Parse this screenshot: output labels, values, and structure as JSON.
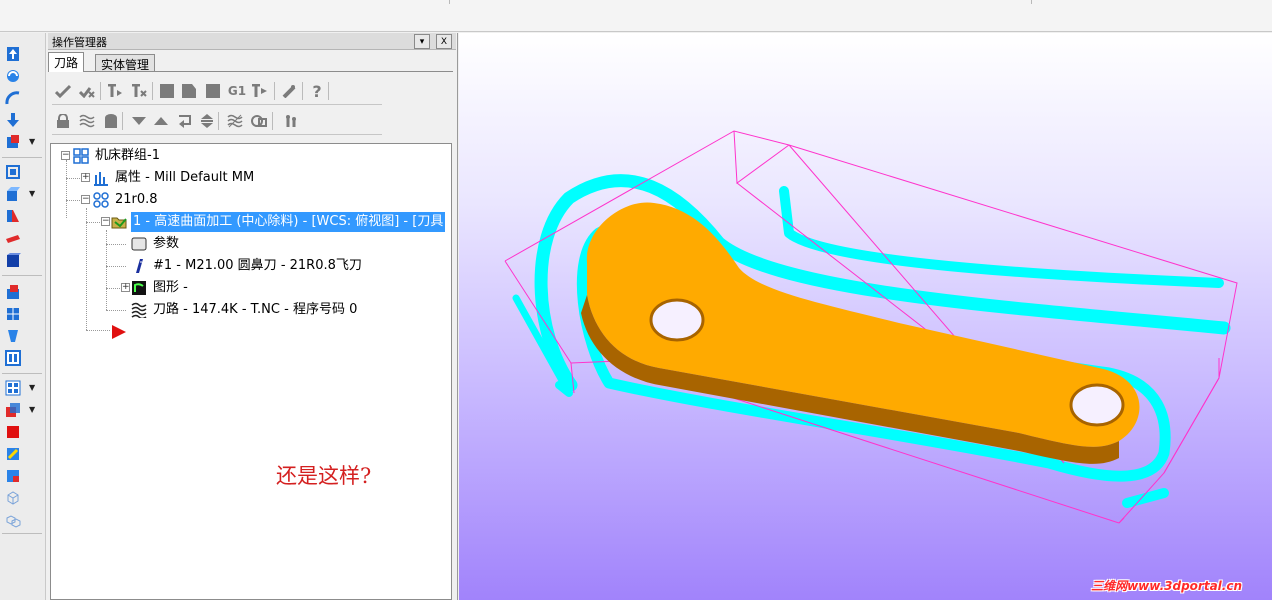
{
  "panel": {
    "title": "操作管理器",
    "pin_glyph": "▾",
    "close_glyph": "X",
    "tabs": [
      {
        "label": "刀路",
        "active": true
      },
      {
        "label": "实体管理",
        "active": false
      }
    ]
  },
  "toolbar_row1": [
    "select-all-ops-icon",
    "select-dirty-ops-icon",
    "regenerate-selected-icon",
    "regenerate-dirty-icon",
    "backplot-icon",
    "verify-icon",
    "simulate-icon",
    "post-selected-icon",
    "high-speed-toolpath-icon",
    "delete-ops-icon",
    "help-icon"
  ],
  "toolbar_g1_label": "G1",
  "toolbar_help_glyph": "?",
  "tree": {
    "nodes": [
      {
        "label": "机床群组-1",
        "icon": "machine-group-icon"
      },
      {
        "label": "属性 - Mill Default MM",
        "icon": "properties-icon"
      },
      {
        "label": "21r0.8",
        "icon": "toolpath-group-icon"
      },
      {
        "label": "1 - 高速曲面加工 (中心除料) - [WCS: 俯视图] - [刀具",
        "icon": "operation-folder-icon",
        "selected": true
      },
      {
        "label": "参数",
        "icon": "parameters-icon"
      },
      {
        "label": "#1 - M21.00 圆鼻刀 - 21R0.8飞刀",
        "icon": "tool-icon"
      },
      {
        "label": "图形 -",
        "icon": "geometry-icon"
      },
      {
        "label": "刀路 - 147.4K - T.NC - 程序号码 0",
        "icon": "toolpath-file-icon"
      }
    ],
    "insert_arrow": "insert-arrow-icon"
  },
  "annotation": "还是这样?",
  "viewport": {
    "watermark": "三维网www.3dportal.cn",
    "colors": {
      "part": "#ffaa00",
      "part_side": "#b06a00",
      "toolpath": "#00ffff",
      "stock": "#ff33cc",
      "background_bottom": "#a183fb"
    }
  }
}
